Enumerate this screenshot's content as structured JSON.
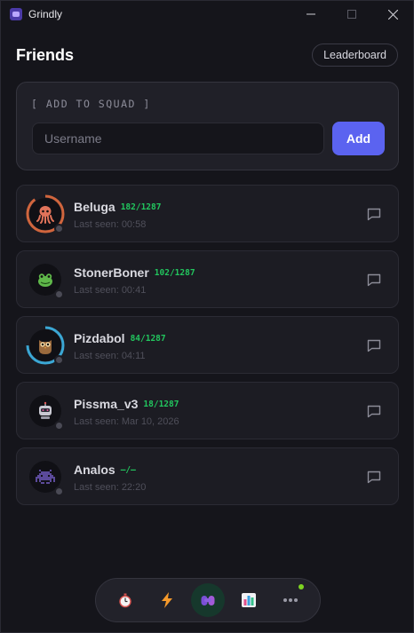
{
  "window": {
    "title": "Grindly",
    "controls": [
      "minimize-icon",
      "maximize-icon",
      "close-icon"
    ]
  },
  "header": {
    "title": "Friends",
    "leaderboard_label": "Leaderboard"
  },
  "squad": {
    "label": "[ ADD TO SQUAD ]",
    "placeholder": "Username",
    "add_label": "Add"
  },
  "friends": [
    {
      "name": "Beluga",
      "progress": "182/1287",
      "last_seen": "Last seen: 00:58",
      "avatar": "octopus-icon",
      "ring_color": "#d0653d",
      "ring_fraction": 0.9
    },
    {
      "name": "StonerBoner",
      "progress": "102/1287",
      "last_seen": "Last seen: 00:41",
      "avatar": "frog-icon",
      "ring_color": "",
      "ring_fraction": 0
    },
    {
      "name": "Pizdabol",
      "progress": "84/1287",
      "last_seen": "Last seen: 04:11",
      "avatar": "owl-icon",
      "ring_color": "#3ba7d4",
      "ring_fraction": 0.75
    },
    {
      "name": "Pissma_v3",
      "progress": "18/1287",
      "last_seen": "Last seen: Mar 10, 2026",
      "avatar": "robot-icon",
      "ring_color": "",
      "ring_fraction": 0
    },
    {
      "name": "Analos",
      "progress": "—/—",
      "last_seen": "Last seen: 22:20",
      "avatar": "space-invader-icon",
      "ring_color": "",
      "ring_fraction": 0
    }
  ],
  "nav": {
    "items": [
      "stopwatch-icon",
      "lightning-icon",
      "friends-icon",
      "chart-icon",
      "more-icon"
    ],
    "active": "friends-icon",
    "notification_on": "more-icon",
    "colors": {
      "accent": "#5b63f0",
      "active_bg": "#16382c",
      "notif": "#7ed321",
      "progress": "#22c55e"
    }
  }
}
